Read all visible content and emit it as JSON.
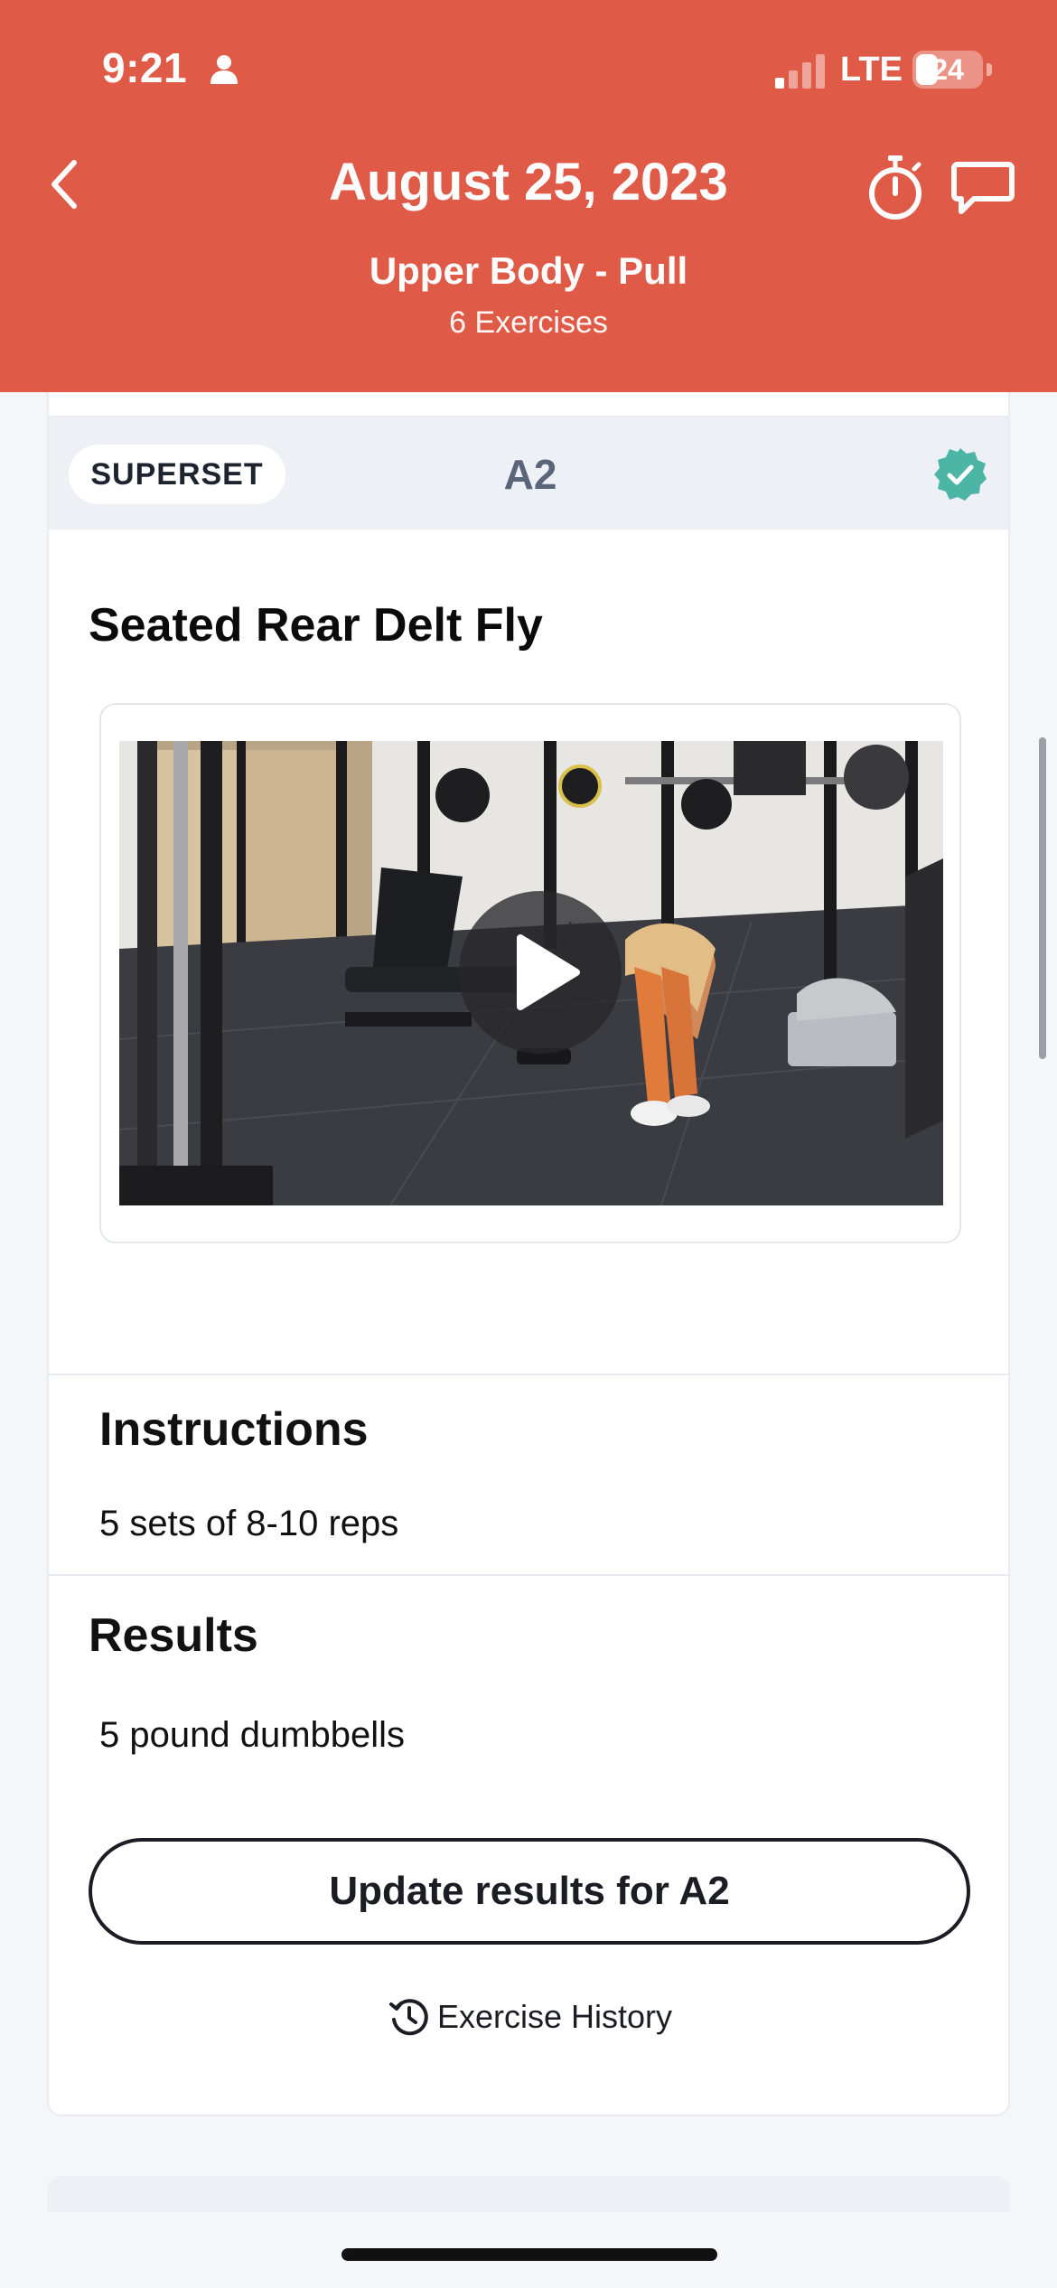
{
  "status_bar": {
    "time": "9:21",
    "network": "LTE",
    "battery": "24"
  },
  "header": {
    "title": "August 25, 2023",
    "workout_name": "Upper Body - Pull",
    "exercise_count": "6 Exercises",
    "accent_color": "#e05a48"
  },
  "superset": {
    "badge": "SUPERSET",
    "code": "A2",
    "completed": true,
    "check_color": "#4cb5a5"
  },
  "exercise": {
    "name": "Seated Rear Delt Fly"
  },
  "instructions": {
    "title": "Instructions",
    "text": "5 sets of 8-10 reps"
  },
  "results": {
    "title": "Results",
    "text": "5 pound dumbbells",
    "update_button": "Update results for A2",
    "history_link": "Exercise History"
  }
}
